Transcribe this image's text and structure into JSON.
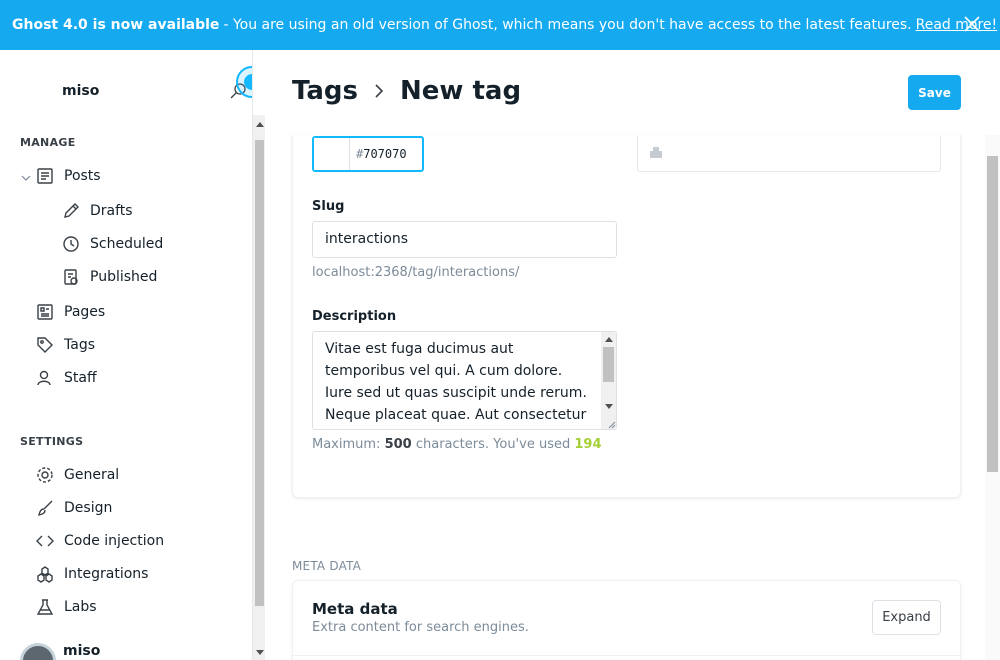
{
  "banner": {
    "title": "Ghost 4.0 is now available",
    "text": "- You are using an old version of Ghost, which means you don't have access to the latest features.",
    "link": "Read more!"
  },
  "sidebar": {
    "brand": "miso",
    "manage_heading": "MANAGE",
    "settings_heading": "SETTINGS",
    "manage_items": [
      {
        "label": "Posts",
        "icon": "posts-icon"
      },
      {
        "label": "Drafts",
        "icon": "pencil-icon"
      },
      {
        "label": "Scheduled",
        "icon": "clock-icon"
      },
      {
        "label": "Published",
        "icon": "published-icon"
      },
      {
        "label": "Pages",
        "icon": "pages-icon"
      },
      {
        "label": "Tags",
        "icon": "tag-icon"
      },
      {
        "label": "Staff",
        "icon": "staff-icon"
      }
    ],
    "settings_items": [
      {
        "label": "General",
        "icon": "gear-icon"
      },
      {
        "label": "Design",
        "icon": "brush-icon"
      },
      {
        "label": "Code injection",
        "icon": "code-icon"
      },
      {
        "label": "Integrations",
        "icon": "integrations-icon"
      },
      {
        "label": "Labs",
        "icon": "flask-icon"
      }
    ],
    "user_name": "miso"
  },
  "header": {
    "crumb_parent": "Tags",
    "crumb_current": "New tag",
    "save_label": "Save"
  },
  "form": {
    "color_hash": "#",
    "color_value": "707070",
    "slug_label": "Slug",
    "slug_value": "interactions",
    "slug_url": "localhost:2368/tag/interactions/",
    "description_label": "Description",
    "description_value": "Vitae est fuga ducimus aut temporibus vel qui. A cum dolore. Iure sed ut quas suscipit unde rerum. Neque placeat quae. Aut consectetur quibusdam",
    "max_prefix": "Maximum:",
    "max_value": "500",
    "max_middle": "characters. You've used",
    "used_value": "194"
  },
  "meta": {
    "section_heading": "META DATA",
    "title": "Meta data",
    "subtitle": "Extra content for search engines.",
    "expand_label": "Expand"
  },
  "colors": {
    "accent": "#15aaf0",
    "used_count": "#a4d037"
  }
}
